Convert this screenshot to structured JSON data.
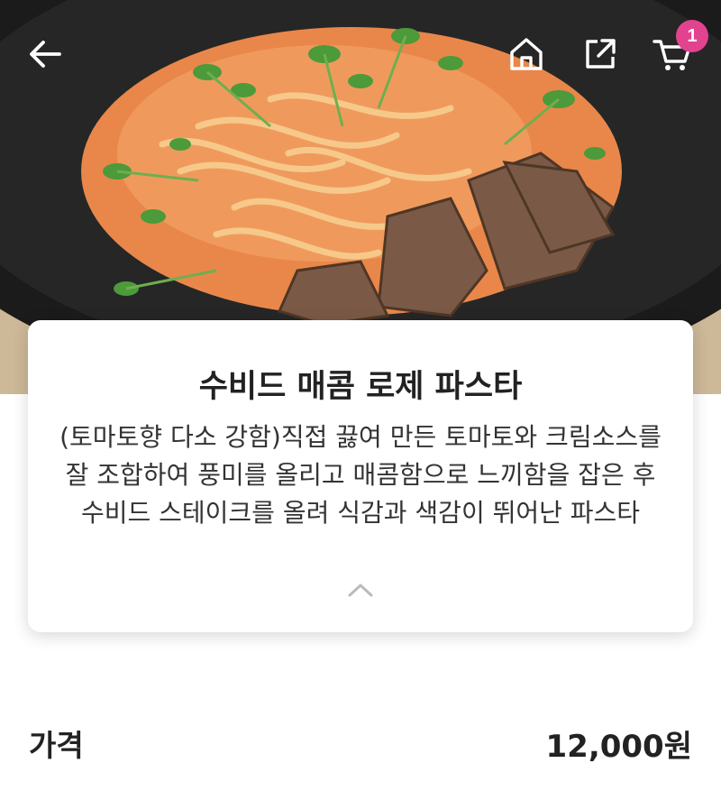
{
  "header": {
    "back_icon": "arrow-left-icon",
    "home_icon": "home-icon",
    "share_icon": "share-icon",
    "cart_icon": "cart-icon",
    "cart_count": "1",
    "badge_color": "#e2438f"
  },
  "hero": {
    "image": "pasta-photo"
  },
  "product": {
    "title": "수비드 매콤 로제 파스타",
    "description": "(토마토향 다소 강함)직접 끓여 만든 토마토와 크림소스를 잘 조합하여 풍미를 올리고 매콤함으로 느끼함을 잡은 후 수비드 스테이크를 올려 식감과 색감이 뛰어난 파스타",
    "collapse_icon": "chevron-up-icon"
  },
  "price": {
    "label": "가격",
    "value": "12,000원"
  }
}
